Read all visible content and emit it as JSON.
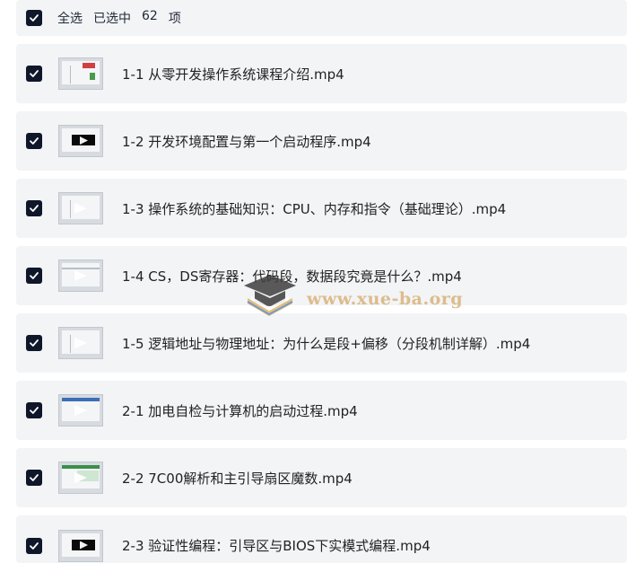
{
  "header": {
    "select_all": "全选",
    "selected_label": "已选中",
    "selected_count": "62",
    "unit": "项"
  },
  "files": [
    {
      "name": "1-1 从零开发操作系统课程介绍.mp4",
      "checked": true,
      "thumb": "ppt-red"
    },
    {
      "name": "1-2 开发环境配置与第一个启动程序.mp4",
      "checked": true,
      "thumb": "dark-player"
    },
    {
      "name": "1-3 操作系统的基础知识：CPU、内存和指令（基础理论）.mp4",
      "checked": true,
      "thumb": "slide"
    },
    {
      "name": "1-4 CS，DS寄存器：代码段，数据段究竟是什么？.mp4",
      "checked": true,
      "thumb": "slide"
    },
    {
      "name": "1-5 逻辑地址与物理地址：为什么是段+偏移（分段机制详解）.mp4",
      "checked": true,
      "thumb": "slide"
    },
    {
      "name": "2-1 加电自检与计算机的启动过程.mp4",
      "checked": true,
      "thumb": "blue-window"
    },
    {
      "name": "2-2 7C00解析和主引导扇区魔数.mp4",
      "checked": true,
      "thumb": "green-window"
    },
    {
      "name": "2-3 验证性编程：引导区与BIOS下实模式编程.mp4",
      "checked": true,
      "thumb": "dark-player"
    }
  ],
  "watermark": {
    "text": "www.xue-ba.org",
    "icon": "graduation-cap-icon"
  },
  "colors": {
    "row_background": "#f3f4f6",
    "checkbox": "#0f172a",
    "text": "#222222"
  }
}
